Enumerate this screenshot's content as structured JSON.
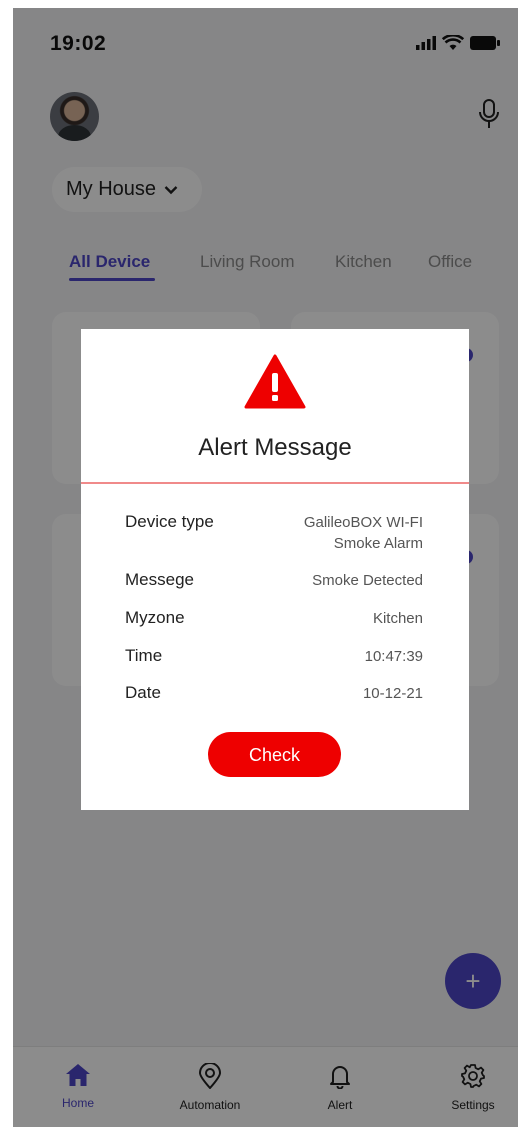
{
  "status_bar": {
    "time": "19:02"
  },
  "header": {
    "house_label": "My House"
  },
  "tabs": [
    {
      "label": "All Device"
    },
    {
      "label": "Living Room"
    },
    {
      "label": "Kitchen"
    },
    {
      "label": "Office"
    }
  ],
  "fab": {
    "label": "+"
  },
  "nav": {
    "items": [
      {
        "label": "Home"
      },
      {
        "label": "Automation"
      },
      {
        "label": "Alert"
      },
      {
        "label": "Settings"
      }
    ]
  },
  "alert": {
    "title": "Alert Message",
    "rows": [
      {
        "key": "Device type",
        "value_line1": "GalileoBOX WI-FI",
        "value_line2": "Smoke Alarm"
      },
      {
        "key": "Messege",
        "value": "Smoke Detected"
      },
      {
        "key": "Myzone",
        "value": "Kitchen"
      },
      {
        "key": "Time",
        "value": "10:47:39"
      },
      {
        "key": "Date",
        "value": "10-12-21"
      }
    ],
    "button_label": "Check"
  },
  "colors": {
    "accent": "#4d46c7",
    "alert_red": "#ee0000",
    "divider": "#f08a8a"
  }
}
